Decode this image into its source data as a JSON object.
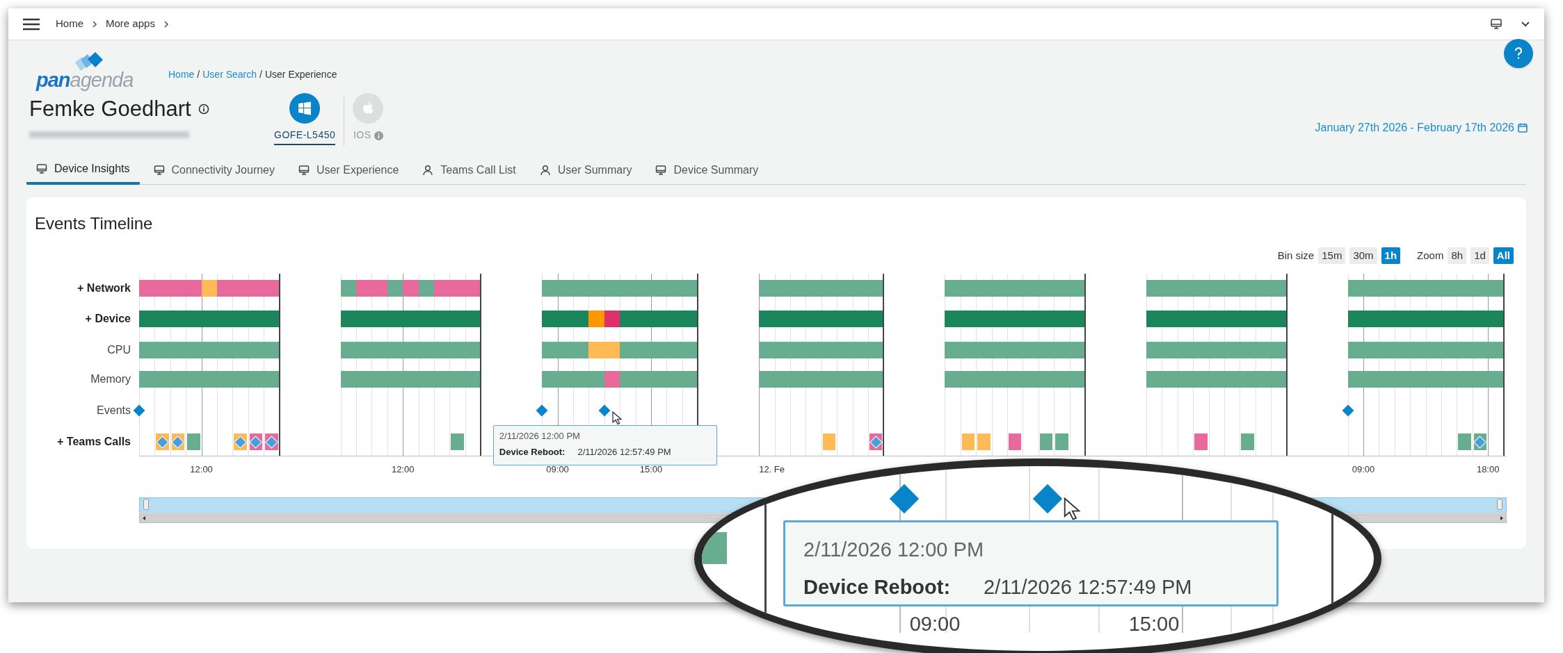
{
  "topbar": {
    "breadcrumb": [
      "Home",
      "More apps"
    ]
  },
  "logo": {
    "part_1": "pan",
    "part_2": "agenda"
  },
  "breadcrumb": {
    "separator": "/",
    "items": [
      {
        "label": "Home",
        "link": true
      },
      {
        "label": "User Search",
        "link": true
      },
      {
        "label": "User Experience",
        "link": false
      }
    ]
  },
  "user": {
    "name": "Femke Goedhart"
  },
  "devices": [
    {
      "label": "GOFE-L5450",
      "kind": "windows",
      "selected": true
    },
    {
      "label": "IOS",
      "kind": "apple",
      "selected": false
    }
  ],
  "date_range": "January 27th 2026 - February 17th 2026",
  "tabs": [
    {
      "label": "Device Insights",
      "kind": "device",
      "selected": true
    },
    {
      "label": "Connectivity Journey",
      "kind": "device",
      "selected": false
    },
    {
      "label": "User Experience",
      "kind": "device",
      "selected": false
    },
    {
      "label": "Teams Call List",
      "kind": "user",
      "selected": false
    },
    {
      "label": "User Summary",
      "kind": "user",
      "selected": false
    },
    {
      "label": "Device Summary",
      "kind": "device",
      "selected": false
    }
  ],
  "timeline": {
    "title": "Events Timeline",
    "bin_size": {
      "label": "Bin size",
      "options": [
        {
          "label": "15m",
          "selected": false
        },
        {
          "label": "30m",
          "selected": false
        },
        {
          "label": "1h",
          "selected": true
        }
      ]
    },
    "zoom": {
      "label": "Zoom",
      "options": [
        {
          "label": "8h",
          "selected": false
        },
        {
          "label": "1d",
          "selected": false
        },
        {
          "label": "All",
          "selected": true
        }
      ]
    },
    "rows": [
      {
        "label": "+ Network",
        "kind": "group"
      },
      {
        "label": "+ Device",
        "kind": "group"
      },
      {
        "label": "CPU",
        "kind": "metric"
      },
      {
        "label": "Memory",
        "kind": "metric"
      },
      {
        "label": "Events",
        "kind": "metric"
      },
      {
        "label": "+ Teams Calls",
        "kind": "group"
      }
    ],
    "days": [
      {
        "hours": [
          {
            "cells": [
              {
                "color": "#e8699b"
              },
              {
                "color": "#1b855c"
              },
              {
                "color": "#69ad91"
              },
              {
                "color": "#69ad91"
              }
            ],
            "event": true
          },
          {
            "cells": [
              {
                "color": "#e8699b"
              },
              {
                "color": "#1b855c"
              },
              {
                "color": "#69ad91"
              },
              {
                "color": "#69ad91"
              }
            ],
            "call": {
              "color": "#ffba55",
              "diamond": true
            }
          },
          {
            "cells": [
              {
                "color": "#e8699b"
              },
              {
                "color": "#1b855c"
              },
              {
                "color": "#69ad91"
              },
              {
                "color": "#69ad91"
              }
            ],
            "call": {
              "color": "#ffba55",
              "diamond": true
            }
          },
          {
            "cells": [
              {
                "color": "#e8699b"
              },
              {
                "color": "#1b855c"
              },
              {
                "color": "#69ad91"
              },
              {
                "color": "#69ad91"
              }
            ],
            "call": {
              "color": "#69ad91",
              "diamond": false
            }
          },
          {
            "cells": [
              {
                "color": "#ffba55"
              },
              {
                "color": "#1b855c"
              },
              {
                "color": "#69ad91"
              },
              {
                "color": "#69ad91"
              }
            ],
            "tick": {
              "label": "12:00",
              "kind": "time"
            }
          },
          {
            "cells": [
              {
                "color": "#e8699b"
              },
              {
                "color": "#1b855c"
              },
              {
                "color": "#69ad91"
              },
              {
                "color": "#69ad91"
              }
            ]
          },
          {
            "cells": [
              {
                "color": "#e8699b"
              },
              {
                "color": "#1b855c"
              },
              {
                "color": "#69ad91"
              },
              {
                "color": "#69ad91"
              }
            ],
            "call": {
              "color": "#ffba55",
              "diamond": true
            }
          },
          {
            "cells": [
              {
                "color": "#e8699b"
              },
              {
                "color": "#1b855c"
              },
              {
                "color": "#69ad91"
              },
              {
                "color": "#69ad91"
              }
            ],
            "call": {
              "color": "#e8699b",
              "diamond": true
            }
          },
          {
            "cells": [
              {
                "color": "#e8699b"
              },
              {
                "color": "#1b855c"
              },
              {
                "color": "#69ad91"
              },
              {
                "color": "#69ad91"
              }
            ],
            "call": {
              "color": "#e8699b",
              "diamond": true
            }
          }
        ]
      },
      {
        "hours": [
          {
            "cells": [
              {
                "color": "#69ad91"
              },
              {
                "color": "#1b855c"
              },
              {
                "color": "#69ad91"
              },
              {
                "color": "#69ad91"
              }
            ]
          },
          {
            "cells": [
              {
                "color": "#e8699b"
              },
              {
                "color": "#1b855c"
              },
              {
                "color": "#69ad91"
              },
              {
                "color": "#69ad91"
              }
            ]
          },
          {
            "cells": [
              {
                "color": "#e8699b"
              },
              {
                "color": "#1b855c"
              },
              {
                "color": "#69ad91"
              },
              {
                "color": "#69ad91"
              }
            ]
          },
          {
            "cells": [
              {
                "color": "#69ad91"
              },
              {
                "color": "#1b855c"
              },
              {
                "color": "#69ad91"
              },
              {
                "color": "#69ad91"
              }
            ]
          },
          {
            "cells": [
              {
                "color": "#e8699b"
              },
              {
                "color": "#1b855c"
              },
              {
                "color": "#69ad91"
              },
              {
                "color": "#69ad91"
              }
            ],
            "tick": {
              "label": "12:00",
              "kind": "time"
            }
          },
          {
            "cells": [
              {
                "color": "#69ad91"
              },
              {
                "color": "#1b855c"
              },
              {
                "color": "#69ad91"
              },
              {
                "color": "#69ad91"
              }
            ]
          },
          {
            "cells": [
              {
                "color": "#e8699b"
              },
              {
                "color": "#1b855c"
              },
              {
                "color": "#69ad91"
              },
              {
                "color": "#69ad91"
              }
            ]
          },
          {
            "cells": [
              {
                "color": "#e8699b"
              },
              {
                "color": "#1b855c"
              },
              {
                "color": "#69ad91"
              },
              {
                "color": "#69ad91"
              }
            ],
            "call": {
              "color": "#69ad91",
              "diamond": false
            }
          },
          {
            "cells": [
              {
                "color": "#e8699b"
              },
              {
                "color": "#1b855c"
              },
              {
                "color": "#69ad91"
              },
              {
                "color": "#69ad91"
              }
            ]
          }
        ]
      },
      {
        "hours": [
          {
            "cells": [
              {
                "color": "#69ad91"
              },
              {
                "color": "#1b855c"
              },
              {
                "color": "#69ad91"
              },
              {
                "color": "#69ad91"
              }
            ],
            "event": true
          },
          {
            "cells": [
              {
                "color": "#69ad91"
              },
              {
                "color": "#1b855c"
              },
              {
                "color": "#69ad91"
              },
              {
                "color": "#69ad91"
              }
            ],
            "tick": {
              "label": "09:00",
              "kind": "time"
            }
          },
          {
            "cells": [
              {
                "color": "#69ad91"
              },
              {
                "color": "#1b855c"
              },
              {
                "color": "#69ad91"
              },
              {
                "color": "#69ad91"
              }
            ]
          },
          {
            "cells": [
              {
                "color": "#69ad91"
              },
              {
                "color": "#ff9800"
              },
              {
                "color": "#ffba55"
              },
              {
                "color": "#69ad91"
              }
            ]
          },
          {
            "cells": [
              {
                "color": "#69ad91"
              },
              {
                "color": "#e0306c"
              },
              {
                "color": "#ffba55"
              },
              {
                "color": "#e8699b"
              }
            ],
            "event": true,
            "tooltip": {
              "title": "2/11/2026 12:00 PM",
              "label": "Device Reboot:",
              "value": "2/11/2026 12:57:49 PM"
            }
          },
          {
            "cells": [
              {
                "color": "#69ad91"
              },
              {
                "color": "#1b855c"
              },
              {
                "color": "#69ad91"
              },
              {
                "color": "#69ad91"
              }
            ]
          },
          {
            "cells": [
              {
                "color": "#69ad91"
              },
              {
                "color": "#1b855c"
              },
              {
                "color": "#69ad91"
              },
              {
                "color": "#69ad91"
              }
            ]
          },
          {
            "cells": [
              {
                "color": "#69ad91"
              },
              {
                "color": "#1b855c"
              },
              {
                "color": "#69ad91"
              },
              {
                "color": "#69ad91"
              }
            ],
            "tick": {
              "label": "15:00",
              "kind": "time"
            }
          },
          {
            "cells": [
              {
                "color": "#69ad91"
              },
              {
                "color": "#1b855c"
              },
              {
                "color": "#69ad91"
              },
              {
                "color": "#69ad91"
              }
            ]
          },
          {
            "cells": [
              {
                "color": "#69ad91"
              },
              {
                "color": "#1b855c"
              },
              {
                "color": "#69ad91"
              },
              {
                "color": "#69ad91"
              }
            ]
          }
        ]
      },
      {
        "hours": [
          {
            "cells": [
              {
                "color": "#69ad91"
              },
              {
                "color": "#1b855c"
              },
              {
                "color": "#69ad91"
              },
              {
                "color": "#69ad91"
              }
            ],
            "tick": {
              "label": "12. Fe",
              "kind": "date"
            }
          },
          {
            "cells": [
              {
                "color": "#69ad91"
              },
              {
                "color": "#1b855c"
              },
              {
                "color": "#69ad91"
              },
              {
                "color": "#69ad91"
              }
            ]
          },
          {
            "cells": [
              {
                "color": "#69ad91"
              },
              {
                "color": "#1b855c"
              },
              {
                "color": "#69ad91"
              },
              {
                "color": "#69ad91"
              }
            ]
          },
          {
            "cells": [
              {
                "color": "#69ad91"
              },
              {
                "color": "#1b855c"
              },
              {
                "color": "#69ad91"
              },
              {
                "color": "#69ad91"
              }
            ]
          },
          {
            "cells": [
              {
                "color": "#69ad91"
              },
              {
                "color": "#1b855c"
              },
              {
                "color": "#69ad91"
              },
              {
                "color": "#69ad91"
              }
            ],
            "call": {
              "color": "#ffba55",
              "diamond": false
            }
          },
          {
            "cells": [
              {
                "color": "#69ad91"
              },
              {
                "color": "#1b855c"
              },
              {
                "color": "#69ad91"
              },
              {
                "color": "#69ad91"
              }
            ]
          },
          {
            "cells": [
              {
                "color": "#69ad91"
              },
              {
                "color": "#1b855c"
              },
              {
                "color": "#69ad91"
              },
              {
                "color": "#69ad91"
              }
            ]
          },
          {
            "cells": [
              {
                "color": "#69ad91"
              },
              {
                "color": "#1b855c"
              },
              {
                "color": "#69ad91"
              },
              {
                "color": "#69ad91"
              }
            ],
            "call": {
              "color": "#e8699b",
              "diamond": true
            }
          }
        ]
      },
      {
        "hours": [
          {
            "cells": [
              {
                "color": "#69ad91"
              },
              {
                "color": "#1b855c"
              },
              {
                "color": "#69ad91"
              },
              {
                "color": "#69ad91"
              }
            ]
          },
          {
            "cells": [
              {
                "color": "#69ad91"
              },
              {
                "color": "#1b855c"
              },
              {
                "color": "#69ad91"
              },
              {
                "color": "#69ad91"
              }
            ],
            "call": {
              "color": "#ffba55",
              "diamond": false
            }
          },
          {
            "cells": [
              {
                "color": "#69ad91"
              },
              {
                "color": "#1b855c"
              },
              {
                "color": "#69ad91"
              },
              {
                "color": "#69ad91"
              }
            ],
            "call": {
              "color": "#ffba55",
              "diamond": false
            }
          },
          {
            "cells": [
              {
                "color": "#69ad91"
              },
              {
                "color": "#1b855c"
              },
              {
                "color": "#69ad91"
              },
              {
                "color": "#69ad91"
              }
            ]
          },
          {
            "cells": [
              {
                "color": "#69ad91"
              },
              {
                "color": "#1b855c"
              },
              {
                "color": "#69ad91"
              },
              {
                "color": "#69ad91"
              }
            ],
            "call": {
              "color": "#e8699b",
              "diamond": false
            }
          },
          {
            "cells": [
              {
                "color": "#69ad91"
              },
              {
                "color": "#1b855c"
              },
              {
                "color": "#69ad91"
              },
              {
                "color": "#69ad91"
              }
            ]
          },
          {
            "cells": [
              {
                "color": "#69ad91"
              },
              {
                "color": "#1b855c"
              },
              {
                "color": "#69ad91"
              },
              {
                "color": "#69ad91"
              }
            ],
            "call": {
              "color": "#69ad91",
              "diamond": false
            }
          },
          {
            "cells": [
              {
                "color": "#69ad91"
              },
              {
                "color": "#1b855c"
              },
              {
                "color": "#69ad91"
              },
              {
                "color": "#69ad91"
              }
            ],
            "call": {
              "color": "#69ad91",
              "diamond": false
            }
          },
          {
            "cells": [
              {
                "color": "#69ad91"
              },
              {
                "color": "#1b855c"
              },
              {
                "color": "#69ad91"
              },
              {
                "color": "#69ad91"
              }
            ]
          }
        ]
      },
      {
        "hours": [
          {
            "cells": [
              {
                "color": "#69ad91"
              },
              {
                "color": "#1b855c"
              },
              {
                "color": "#69ad91"
              },
              {
                "color": "#69ad91"
              }
            ]
          },
          {
            "cells": [
              {
                "color": "#69ad91"
              },
              {
                "color": "#1b855c"
              },
              {
                "color": "#69ad91"
              },
              {
                "color": "#69ad91"
              }
            ]
          },
          {
            "cells": [
              {
                "color": "#69ad91"
              },
              {
                "color": "#1b855c"
              },
              {
                "color": "#69ad91"
              },
              {
                "color": "#69ad91"
              }
            ]
          },
          {
            "cells": [
              {
                "color": "#69ad91"
              },
              {
                "color": "#1b855c"
              },
              {
                "color": "#69ad91"
              },
              {
                "color": "#69ad91"
              }
            ],
            "call": {
              "color": "#e8699b",
              "diamond": false
            }
          },
          {
            "cells": [
              {
                "color": "#69ad91"
              },
              {
                "color": "#1b855c"
              },
              {
                "color": "#69ad91"
              },
              {
                "color": "#69ad91"
              }
            ]
          },
          {
            "cells": [
              {
                "color": "#69ad91"
              },
              {
                "color": "#1b855c"
              },
              {
                "color": "#69ad91"
              },
              {
                "color": "#69ad91"
              }
            ]
          },
          {
            "cells": [
              {
                "color": "#69ad91"
              },
              {
                "color": "#1b855c"
              },
              {
                "color": "#69ad91"
              },
              {
                "color": "#69ad91"
              }
            ],
            "call": {
              "color": "#69ad91",
              "diamond": false
            }
          },
          {
            "cells": [
              {
                "color": "#69ad91"
              },
              {
                "color": "#1b855c"
              },
              {
                "color": "#69ad91"
              },
              {
                "color": "#69ad91"
              }
            ]
          },
          {
            "cells": [
              {
                "color": "#69ad91"
              },
              {
                "color": "#1b855c"
              },
              {
                "color": "#69ad91"
              },
              {
                "color": "#69ad91"
              }
            ]
          }
        ]
      },
      {
        "hours": [
          {
            "cells": [
              {
                "color": "#69ad91"
              },
              {
                "color": "#1b855c"
              },
              {
                "color": "#69ad91"
              },
              {
                "color": "#69ad91"
              }
            ],
            "event": true
          },
          {
            "cells": [
              {
                "color": "#69ad91"
              },
              {
                "color": "#1b855c"
              },
              {
                "color": "#69ad91"
              },
              {
                "color": "#69ad91"
              }
            ],
            "tick": {
              "label": "09:00",
              "kind": "time"
            }
          },
          {
            "cells": [
              {
                "color": "#69ad91"
              },
              {
                "color": "#1b855c"
              },
              {
                "color": "#69ad91"
              },
              {
                "color": "#69ad91"
              }
            ]
          },
          {
            "cells": [
              {
                "color": "#69ad91"
              },
              {
                "color": "#1b855c"
              },
              {
                "color": "#69ad91"
              },
              {
                "color": "#69ad91"
              }
            ]
          },
          {
            "cells": [
              {
                "color": "#69ad91"
              },
              {
                "color": "#1b855c"
              },
              {
                "color": "#69ad91"
              },
              {
                "color": "#69ad91"
              }
            ]
          },
          {
            "cells": [
              {
                "color": "#69ad91"
              },
              {
                "color": "#1b855c"
              },
              {
                "color": "#69ad91"
              },
              {
                "color": "#69ad91"
              }
            ]
          },
          {
            "cells": [
              {
                "color": "#69ad91"
              },
              {
                "color": "#1b855c"
              },
              {
                "color": "#69ad91"
              },
              {
                "color": "#69ad91"
              }
            ]
          },
          {
            "cells": [
              {
                "color": "#69ad91"
              },
              {
                "color": "#1b855c"
              },
              {
                "color": "#69ad91"
              },
              {
                "color": "#69ad91"
              }
            ],
            "call": {
              "color": "#69ad91",
              "diamond": false
            }
          },
          {
            "cells": [
              {
                "color": "#69ad91"
              },
              {
                "color": "#1b855c"
              },
              {
                "color": "#69ad91"
              },
              {
                "color": "#69ad91"
              }
            ],
            "call": {
              "color": "#69ad91",
              "diamond": true
            }
          },
          {
            "cells": [
              {
                "color": "#69ad91"
              },
              {
                "color": "#1b855c"
              },
              {
                "color": "#69ad91"
              },
              {
                "color": "#69ad91"
              }
            ],
            "tick": {
              "label": "18:00",
              "kind": "time"
            }
          }
        ]
      }
    ]
  },
  "magnifier": {
    "tooltip": {
      "title": "2/11/2026 12:00 PM",
      "label": "Device Reboot:",
      "value": "2/11/2026 12:57:49 PM"
    },
    "x_labels": [
      "09:00",
      "15:00"
    ]
  }
}
